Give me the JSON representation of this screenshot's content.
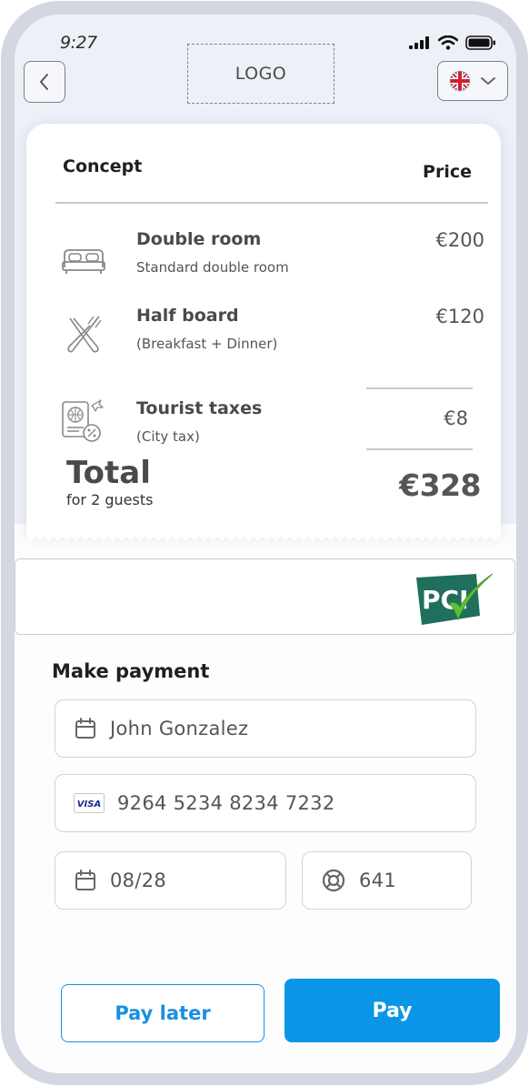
{
  "status_bar": {
    "time": "9:27"
  },
  "header": {
    "logo_text": "LOGO"
  },
  "receipt": {
    "concept_header": "Concept",
    "price_header": "Price",
    "items": [
      {
        "name": "Double room",
        "description": "Standard double room",
        "price": "€200",
        "icon": "bed-icon"
      },
      {
        "name": "Half board",
        "description": "(Breakfast + Dinner)",
        "price": "€120",
        "icon": "fork-knife-icon"
      },
      {
        "name": "Tourist taxes",
        "description": "(City tax)",
        "price": "€8",
        "icon": "passport-tax-icon"
      }
    ],
    "total_label": "Total",
    "total_sub": "for 2 guests",
    "total_amount": "€328"
  },
  "pci": {
    "logo_text": "PCI"
  },
  "payment": {
    "title": "Make payment",
    "cardholder": "John Gonzalez",
    "card_brand": "VISA",
    "card_number": "9264 5234 8234 7232",
    "expiry": "08/28",
    "cvv": "641"
  },
  "buttons": {
    "pay_later": "Pay later",
    "pay": "Pay"
  },
  "colors": {
    "primary": "#0a96e6",
    "pci_green": "#1f6f5c",
    "check_green": "#5bc236"
  }
}
